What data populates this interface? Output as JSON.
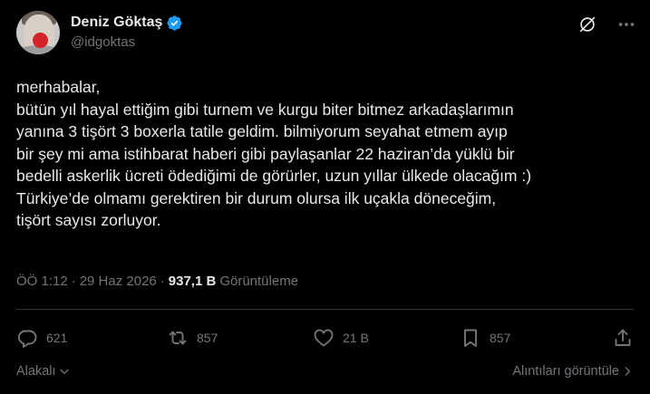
{
  "author": {
    "display_name": "Deniz Göktaş",
    "handle": "@idgoktas",
    "verified": true
  },
  "tweet": {
    "lines": [
      "merhabalar,",
      "bütün yıl hayal ettiğim gibi turnem ve kurgu biter bitmez arkadaşlarımın",
      "yanına 3 tişört 3 boxerla tatile geldim. bilmiyorum seyahat etmem ayıp",
      "bir şey mi ama istihbarat haberi gibi paylaşanlar 22 haziran’da yüklü bir",
      "bedelli askerlik ücreti ödediğimi de görürler, uzun yıllar ülkede olacağım :)",
      "Türkiye’de olmamı gerektiren bir durum olursa ilk uçakla döneceğim,",
      "tişört sayısı zorluyor."
    ],
    "time": "ÖÖ 1:12",
    "separator": "·",
    "date": "29 Haz 2026",
    "views_count": "937,1 B",
    "views_label": "Görüntüleme"
  },
  "actions": {
    "replies": "621",
    "reposts": "857",
    "likes": "21 B",
    "bookmarks": "857"
  },
  "footer": {
    "sort_label": "Alakalı",
    "quotes_label": "Alıntıları görüntüle"
  },
  "colors": {
    "background": "#000000",
    "text": "#e7e9ea",
    "muted": "#71767b",
    "verified": "#1d9bf0",
    "divider": "#2f3336"
  },
  "icons": {
    "verified": "verified-badge-icon",
    "grok": "grok-icon",
    "more": "more-icon",
    "reply": "reply-icon",
    "repost": "repost-icon",
    "like": "heart-icon",
    "bookmark": "bookmark-icon",
    "share": "share-icon"
  }
}
